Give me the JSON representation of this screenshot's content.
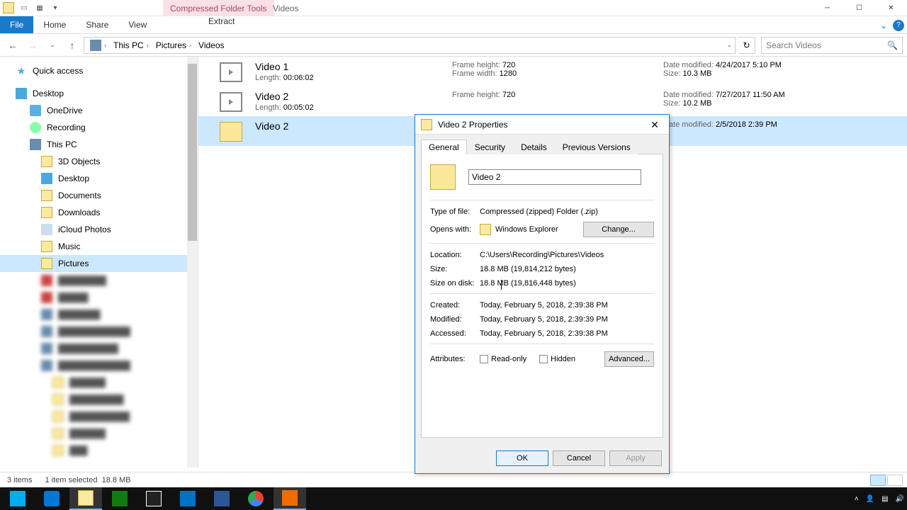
{
  "titlebar": {
    "contextual": "Compressed Folder Tools",
    "title": "Videos"
  },
  "ribbon": {
    "file": "File",
    "home": "Home",
    "share": "Share",
    "view": "View",
    "extract": "Extract"
  },
  "breadcrumb": {
    "b1": "This PC",
    "b2": "Pictures",
    "b3": "Videos"
  },
  "search": {
    "placeholder": "Search Videos"
  },
  "nav": {
    "quick": "Quick access",
    "desktop": "Desktop",
    "onedrive": "OneDrive",
    "recording": "Recording",
    "thispc": "This PC",
    "obj3d": "3D Objects",
    "desktop2": "Desktop",
    "documents": "Documents",
    "downloads": "Downloads",
    "icloud": "iCloud Photos",
    "music": "Music",
    "pictures": "Pictures"
  },
  "files": {
    "r1": {
      "name": "Video 1",
      "length_l": "Length:",
      "length": "00:06:02",
      "fh_l": "Frame height:",
      "fh": "720",
      "fw_l": "Frame width:",
      "fw": "1280",
      "dm_l": "Date modified:",
      "dm": "4/24/2017 5:10 PM",
      "sz_l": "Size:",
      "sz": "10.3 MB"
    },
    "r2": {
      "name": "Video 2",
      "length_l": "Length:",
      "length": "00:05:02",
      "fh_l": "Frame height:",
      "fh": "720",
      "dm_l": "Date modified:",
      "dm": "7/27/2017 11:50 AM",
      "sz_l": "Size:",
      "sz": "10.2 MB"
    },
    "r3": {
      "name": "Video 2",
      "dm_l": "Date modified:",
      "dm": "2/5/2018 2:39 PM"
    }
  },
  "status": {
    "items": "3 items",
    "sel": "1 item selected",
    "size": "18.8 MB"
  },
  "dialog": {
    "title": "Video 2 Properties",
    "tabs": {
      "general": "General",
      "security": "Security",
      "details": "Details",
      "prev": "Previous Versions"
    },
    "filename": "Video 2",
    "type_l": "Type of file:",
    "type": "Compressed (zipped) Folder (.zip)",
    "opens_l": "Opens with:",
    "opens": "Windows Explorer",
    "change": "Change...",
    "loc_l": "Location:",
    "loc": "C:\\Users\\Recording\\Pictures\\Videos",
    "size_l": "Size:",
    "size": "18.8 MB (19,814,212 bytes)",
    "sod_l": "Size on disk:",
    "sod": "18.8 MB (19,816,448 bytes)",
    "created_l": "Created:",
    "created": "Today, February 5, 2018, 2:39:38 PM",
    "modified_l": "Modified:",
    "modified": "Today, February 5, 2018, 2:39:39 PM",
    "accessed_l": "Accessed:",
    "accessed": "Today, February 5, 2018, 2:39:38 PM",
    "attr_l": "Attributes:",
    "readonly": "Read-only",
    "hidden": "Hidden",
    "advanced": "Advanced...",
    "ok": "OK",
    "cancel": "Cancel",
    "apply": "Apply"
  }
}
